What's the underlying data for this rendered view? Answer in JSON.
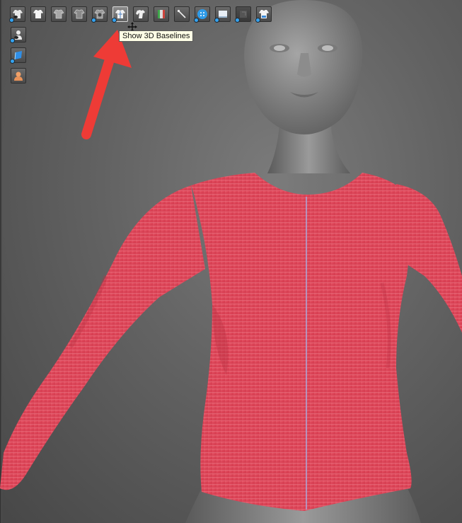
{
  "toolbar": {
    "top_row": [
      {
        "icon": "garment-visibility-icon",
        "dot": true,
        "active": false
      },
      {
        "icon": "white-shirt-icon",
        "dot": false,
        "active": false
      },
      {
        "icon": "gray-shirt-icon",
        "dot": false,
        "active": false
      },
      {
        "icon": "shirt-outline-icon",
        "dot": false,
        "active": false
      },
      {
        "icon": "shirt-settings-icon",
        "dot": true,
        "active": false
      },
      {
        "icon": "baselines-shirt-icon",
        "dot": true,
        "active": true
      },
      {
        "icon": "pose-shirt-icon",
        "dot": false,
        "active": false
      },
      {
        "icon": "texture-map-icon",
        "dot": false,
        "active": false
      },
      {
        "icon": "needle-icon",
        "dot": false,
        "active": false
      },
      {
        "icon": "button-icon",
        "dot": true,
        "active": false
      },
      {
        "icon": "fabric-sheet-icon",
        "dot": true,
        "active": false
      },
      {
        "icon": "dark-square-icon",
        "dot": true,
        "active": false
      },
      {
        "icon": "shirt-blue-icon",
        "dot": true,
        "active": false
      }
    ],
    "side_column": [
      {
        "icon": "avatar-visibility-icon",
        "dot": true
      },
      {
        "icon": "blue-panel-icon",
        "dot": true
      },
      {
        "icon": "avatar-skin-icon",
        "dot": false
      }
    ]
  },
  "tooltip": {
    "text": "Show 3D Baselines"
  },
  "colors": {
    "garment": "#e0475a",
    "avatar": "#8a8a8a",
    "arrow": "#ee3b36",
    "baseline": "#a9a6d8"
  }
}
